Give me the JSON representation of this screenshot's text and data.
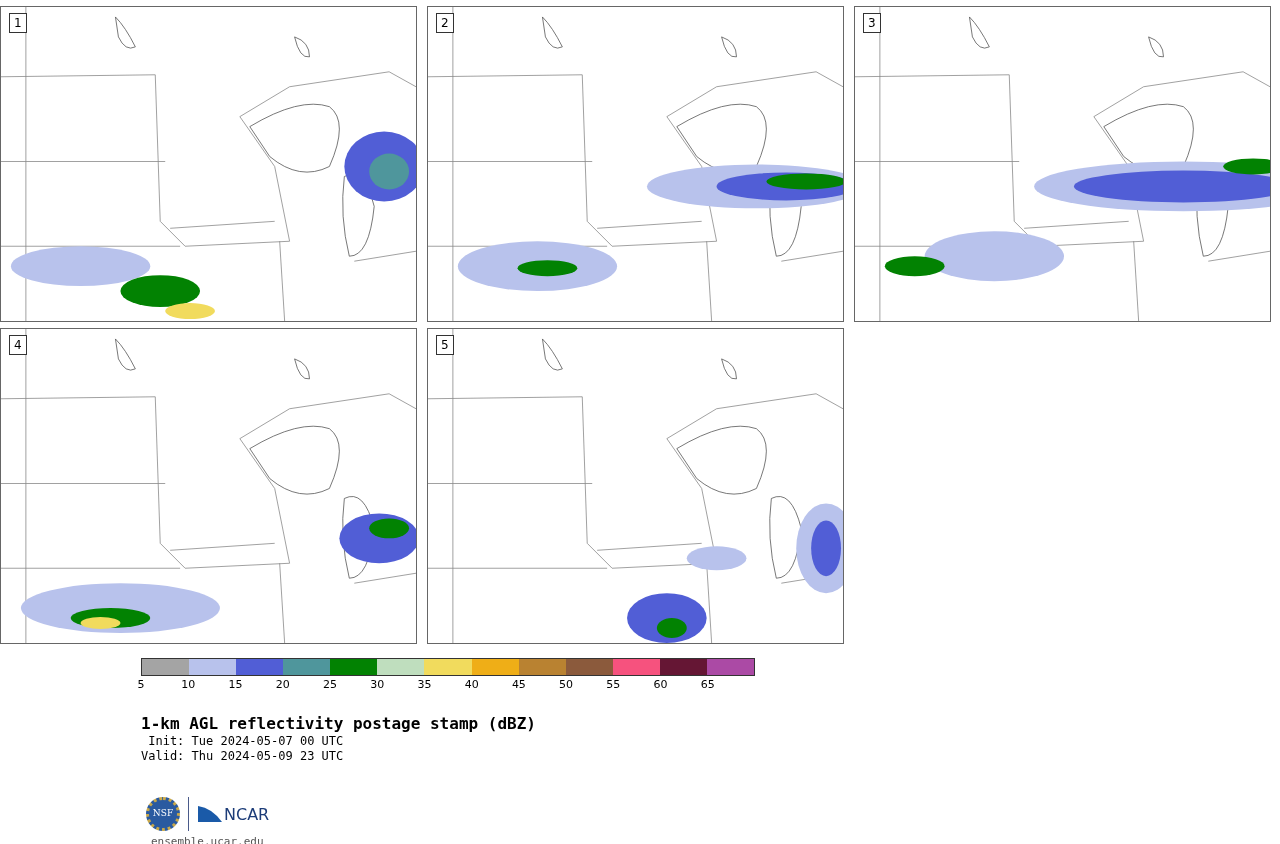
{
  "panels": [
    {
      "label": "1"
    },
    {
      "label": "2"
    },
    {
      "label": "3"
    },
    {
      "label": "4"
    },
    {
      "label": "5"
    }
  ],
  "colorbar": {
    "segments": [
      {
        "color": "#a4a4a4",
        "label": "5"
      },
      {
        "color": "#b8c2ec",
        "label": "10"
      },
      {
        "color": "#515ed6",
        "label": "15"
      },
      {
        "color": "#4f969c",
        "label": "20"
      },
      {
        "color": "#028202",
        "label": "25"
      },
      {
        "color": "#bfdebe",
        "label": "30"
      },
      {
        "color": "#f1db5d",
        "label": "35"
      },
      {
        "color": "#efae17",
        "label": "40"
      },
      {
        "color": "#b98231",
        "label": "45"
      },
      {
        "color": "#8b5a3c",
        "label": "50"
      },
      {
        "color": "#f6527e",
        "label": "55"
      },
      {
        "color": "#651634",
        "label": "60"
      },
      {
        "color": "#ab4aa5",
        "label": "65"
      }
    ]
  },
  "title": "1-km AGL reflectivity postage stamp (dBZ)",
  "init": " Init: Tue 2024-05-07 00 UTC",
  "valid": "Valid: Thu 2024-05-09 23 UTC",
  "logo": {
    "left": "NSF",
    "right": "NCAR"
  },
  "footer": "ensemble.ucar.edu"
}
